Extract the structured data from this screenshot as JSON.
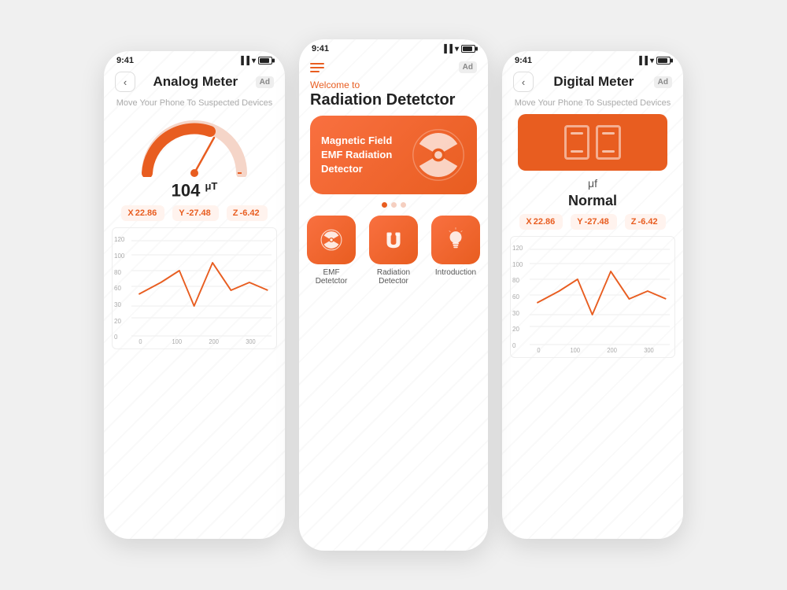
{
  "colors": {
    "orange": "#e85d20",
    "orange_light": "#f97040",
    "bg": "#f0f0f0"
  },
  "left_phone": {
    "status_time": "9:41",
    "title": "Analog Meter",
    "ad_label": "Ad",
    "back_icon": "‹",
    "subtitle": "Move Your Phone To Suspected Devices",
    "reading": "104",
    "unit": "μT",
    "xyz": [
      {
        "axis": "X",
        "value": "22.86"
      },
      {
        "axis": "Y",
        "value": "-27.48"
      },
      {
        "axis": "Z",
        "value": "-6.42"
      }
    ],
    "chart_y_labels": [
      "120",
      "100",
      "80",
      "60",
      "30",
      "20",
      "0"
    ]
  },
  "center_phone": {
    "status_time": "9:41",
    "ad_label": "Ad",
    "welcome_to": "Welcome to",
    "welcome_title": "Radiation Detetctor",
    "banner_text": "Magnetic Field EMF Radiation Detector",
    "dots": [
      "active",
      "inactive",
      "inactive"
    ],
    "features": [
      {
        "label": "EMF Detetctor",
        "icon": "radiation"
      },
      {
        "label": "Radiation Detector",
        "icon": "magnet"
      },
      {
        "label": "Introduction",
        "icon": "bulb"
      }
    ]
  },
  "right_phone": {
    "status_time": "9:41",
    "title": "Digital Meter",
    "ad_label": "Ad",
    "back_icon": "‹",
    "subtitle": "Move Your Phone To Suspected Devices",
    "unit": "μf",
    "status_text": "Normal",
    "xyz": [
      {
        "axis": "X",
        "value": "22.86"
      },
      {
        "axis": "Y",
        "value": "-27.48"
      },
      {
        "axis": "Z",
        "value": "-6.42"
      }
    ],
    "chart_y_labels": [
      "120",
      "100",
      "80",
      "60",
      "30",
      "20",
      "0"
    ]
  }
}
